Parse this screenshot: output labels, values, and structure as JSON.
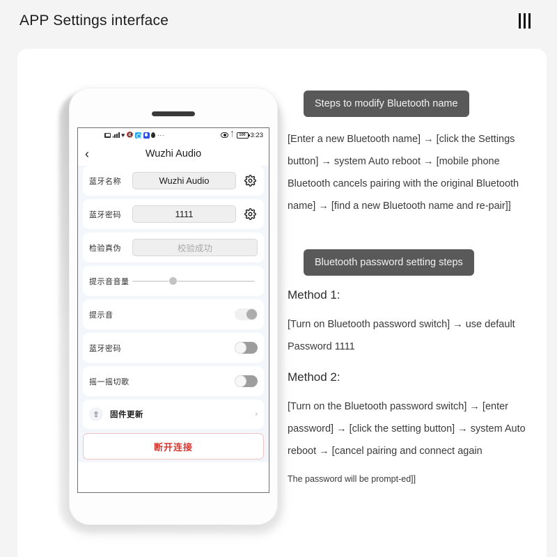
{
  "header": {
    "title": "APP Settings interface",
    "menu_icon": "menu-bars-icon"
  },
  "phone": {
    "status_bar": {
      "icons_left": [
        "sms-icon",
        "signal-icon",
        "heart-icon",
        "mute-icon",
        "app-blue-icon",
        "app-indigo-icon",
        "droplet-icon",
        "more-dots-icon"
      ],
      "more": "···",
      "eye_icon": "eye-icon",
      "bluetooth_icon": "bluetooth-icon",
      "battery_level": "100",
      "time": "3:23"
    },
    "nav": {
      "back_icon": "chevron-left-icon",
      "title": "Wuzhi Audio"
    },
    "rows": [
      {
        "label": "蓝牙名称",
        "type": "field",
        "value": "Wuzhi Audio",
        "action": "gear-icon"
      },
      {
        "label": "蓝牙密码",
        "type": "field",
        "value": "1111",
        "action": "gear-icon"
      },
      {
        "label": "检验真伪",
        "type": "field-disabled",
        "value": "校验成功"
      },
      {
        "label": "提示音音量",
        "type": "slider",
        "value": 33
      },
      {
        "label": "提示音",
        "type": "toggle",
        "state": "on"
      },
      {
        "label": "蓝牙密码",
        "type": "toggle",
        "state": "off"
      },
      {
        "label": "摇一摇切歌",
        "type": "toggle",
        "state": "off"
      }
    ],
    "firmware": {
      "icon": "upload-icon",
      "label": "固件更新",
      "chevron": "chevron-right-icon"
    },
    "disconnect_button": "断开连接"
  },
  "guide": {
    "section1": {
      "chip": "Steps to modify Bluetooth name",
      "body": "[Enter a new Bluetooth name] → [click the Settings button] → system Auto reboot → [mobile phone Bluetooth cancels pairing with the original Bluetooth name] → [find a new Bluetooth name and re-pair]]"
    },
    "section2": {
      "chip": "Bluetooth password setting steps",
      "method1_title": "Method 1:",
      "method1_body": "[Turn on Bluetooth password switch] → use default  Password 1111",
      "method2_title": "Method 2:",
      "method2_body": "[Turn on the Bluetooth password switch] → [enter password] → [click the setting button] → system Auto reboot → [cancel pairing and connect again",
      "method2_note": "The password will be prompt-ed]]"
    }
  },
  "colors": {
    "accent_red": "#d9352f",
    "chip_bg": "#595959",
    "app_blue": "#1fa9ef"
  }
}
